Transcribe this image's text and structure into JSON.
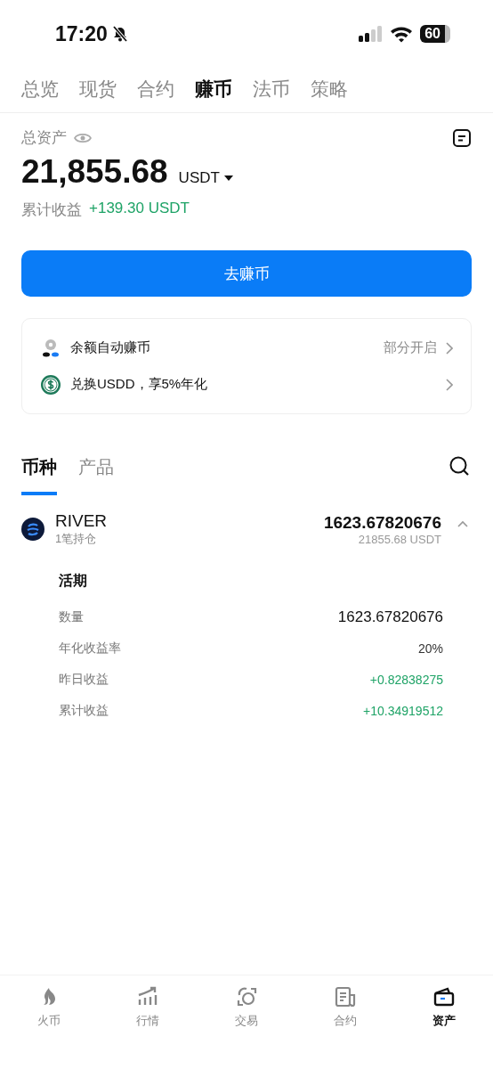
{
  "status_bar": {
    "time": "17:20",
    "battery": "60"
  },
  "top_tabs": [
    {
      "label": "总览",
      "selected": false
    },
    {
      "label": "现货",
      "selected": false
    },
    {
      "label": "合约",
      "selected": false
    },
    {
      "label": "赚币",
      "selected": true
    },
    {
      "label": "法币",
      "selected": false
    },
    {
      "label": "策略",
      "selected": false
    }
  ],
  "assets": {
    "label": "总资产",
    "amount": "21,855.68",
    "currency": "USDT",
    "earnings_label": "累计收益",
    "earnings_value": "+139.30 USDT"
  },
  "primary_button": "去赚币",
  "features": [
    {
      "kind": "auto",
      "label": "余额自动赚币",
      "value": "部分开启"
    },
    {
      "kind": "usdd",
      "label": "兑换USDD，享5%年化"
    }
  ],
  "sub_tabs": [
    {
      "label": "币种",
      "selected": true
    },
    {
      "label": "产品",
      "selected": false
    }
  ],
  "holdings": [
    {
      "name": "RIVER",
      "subtitle": "1笔持仓",
      "amount": "1623.67820676",
      "value": "21855.68 USDT",
      "expanded": true,
      "detail_title": "活期",
      "details": [
        {
          "kind": "strong",
          "label": "数量",
          "value": "1623.67820676"
        },
        {
          "kind": "plain",
          "label": "年化收益率",
          "value": "20%"
        },
        {
          "kind": "positive",
          "label": "昨日收益",
          "value": "+0.82838275"
        },
        {
          "kind": "positive",
          "label": "累计收益",
          "value": "+10.34919512"
        }
      ]
    }
  ],
  "bottom_nav": [
    {
      "kind": "flame",
      "label": "火币",
      "selected": false
    },
    {
      "kind": "chart",
      "label": "行情",
      "selected": false
    },
    {
      "kind": "trade",
      "label": "交易",
      "selected": false
    },
    {
      "kind": "doc",
      "label": "合约",
      "selected": false
    },
    {
      "kind": "wallet",
      "label": "资产",
      "selected": true
    }
  ]
}
